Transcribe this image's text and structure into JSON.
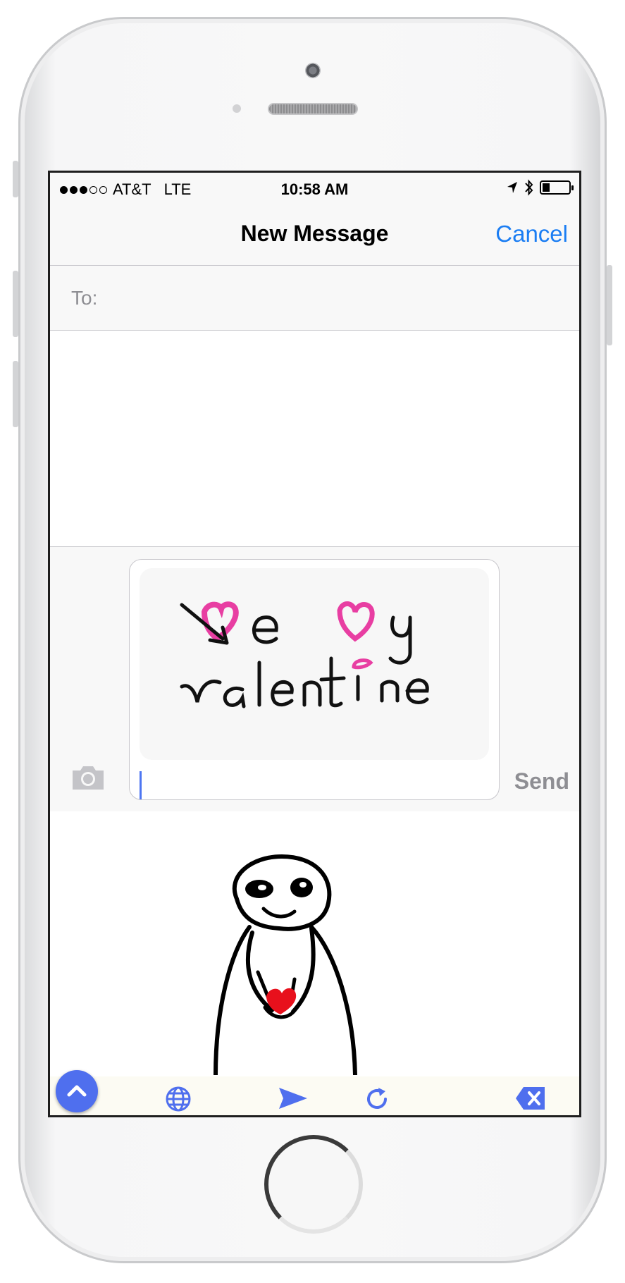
{
  "status_bar": {
    "carrier": "AT&T",
    "network": "LTE",
    "time": "10:58 AM"
  },
  "nav": {
    "title": "New Message",
    "cancel_label": "Cancel"
  },
  "recipient": {
    "label": "To:",
    "value": ""
  },
  "compose": {
    "drawing_text": "Be my Valentine",
    "send_label": "Send"
  },
  "keyboard": {
    "toolbar_icons": [
      "chevron-up-icon",
      "globe-icon",
      "send-icon",
      "refresh-icon",
      "delete-icon"
    ]
  },
  "colors": {
    "accent_blue": "#1a7df3",
    "keyboard_blue": "#4f6fee",
    "heart_pink": "#e83ea2",
    "heart_red": "#e8101c"
  }
}
